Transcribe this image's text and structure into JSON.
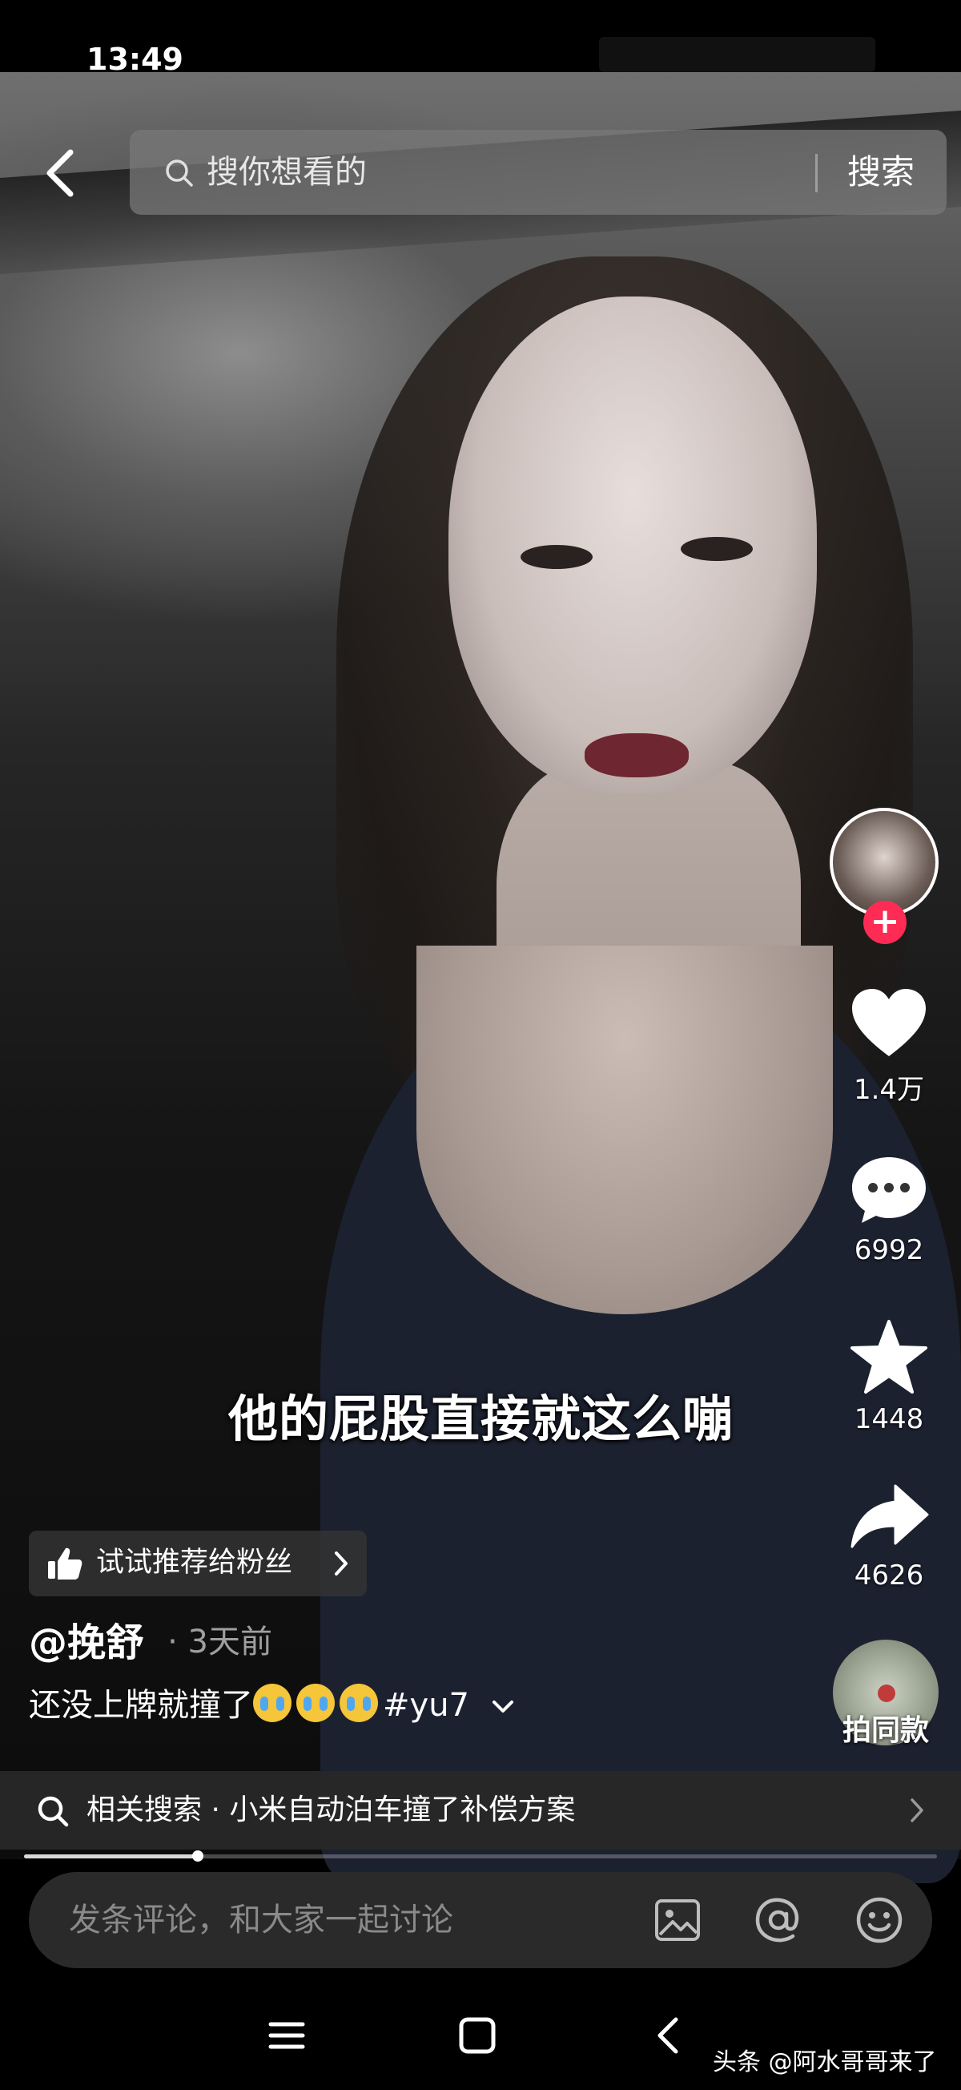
{
  "status_bar": {
    "time": "13:49"
  },
  "search": {
    "placeholder": "搜你想看的",
    "button_label": "搜索"
  },
  "video": {
    "caption": "他的屁股直接就这么嘣",
    "progress": 0.19
  },
  "actions": {
    "like_count": "1.4万",
    "comment_count": "6992",
    "favorite_count": "1448",
    "share_count": "4626",
    "same_style_label": "拍同款"
  },
  "recommend": {
    "label": "试试推荐给粉丝"
  },
  "post": {
    "author": "@挽舒",
    "time": "· 3天前",
    "description_text": "还没上牌就撞了",
    "description_tag": "#yu7"
  },
  "related_search": {
    "label": "相关搜索 · 小米自动泊车撞了补偿方案"
  },
  "comment": {
    "placeholder": "发条评论，和大家一起讨论"
  },
  "watermark": "头条 @阿水哥哥来了",
  "icons": {
    "back": "back-arrow-icon",
    "search": "search-icon",
    "like": "heart-icon",
    "comment": "comment-bubble-icon",
    "favorite": "star-icon",
    "share": "share-arrow-icon",
    "thumb": "thumbs-up-icon",
    "image": "image-icon",
    "mention": "at-icon",
    "emoji": "emoji-icon"
  },
  "colors": {
    "follow_badge": "#fe2c55",
    "background": "#000000"
  }
}
